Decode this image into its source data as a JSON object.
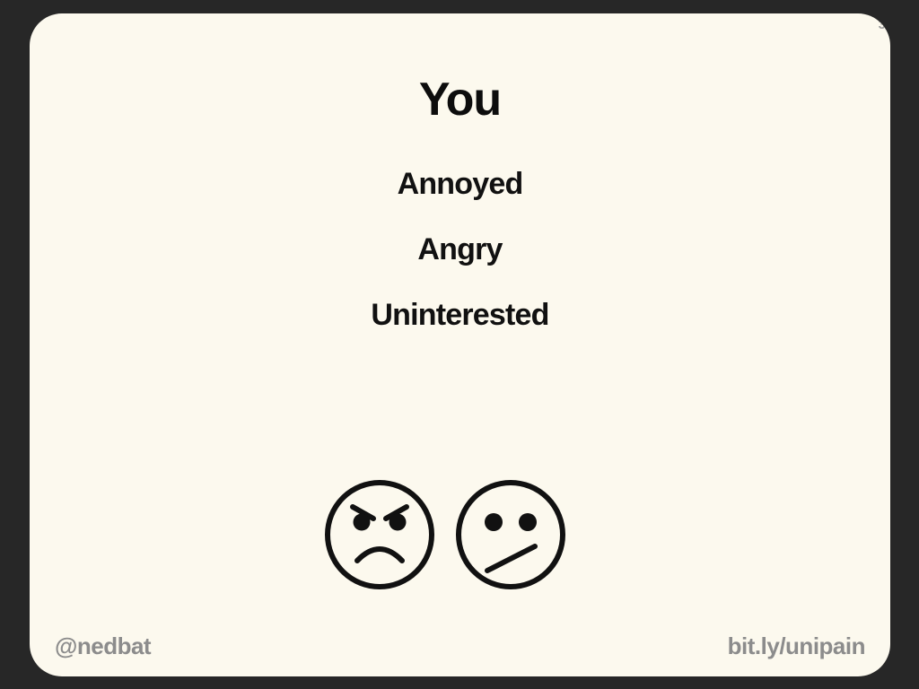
{
  "slide": {
    "counter": "3/45",
    "title": "You",
    "items": [
      "Annoyed",
      "Angry",
      "Uninterested"
    ],
    "faces": [
      {
        "icon": "angry-face-icon"
      },
      {
        "icon": "skeptical-face-icon"
      }
    ],
    "footer_left": "@nedbat",
    "footer_right": "bit.ly/unipain"
  },
  "colors": {
    "background": "#272727",
    "slide": "#fcf9ee",
    "text": "#111111",
    "footer_text": "#8c8c8c",
    "counter_text": "#9a9a9a"
  }
}
